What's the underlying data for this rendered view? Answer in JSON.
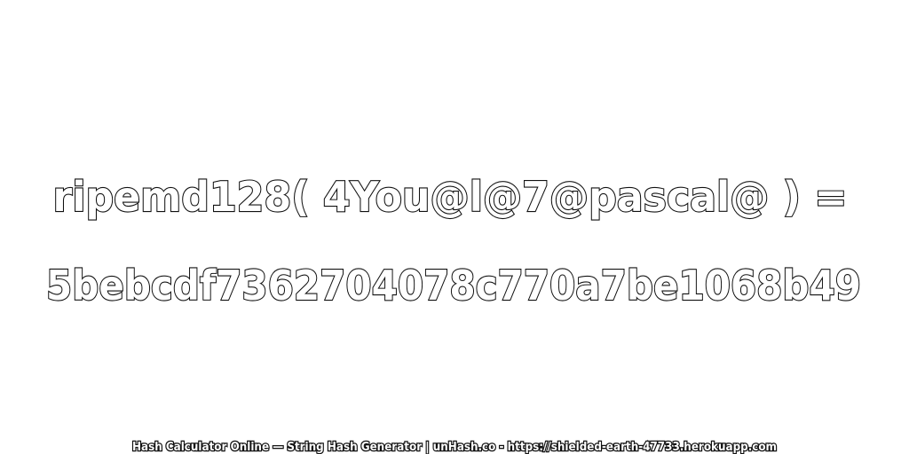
{
  "expression": "ripemd128( 4You@l@7@pascal@ ) =",
  "hash": "5bebcdf7362704078c770a7be1068b49",
  "footer": "Hash Calculator Online — String Hash Generator | unHash.co - https://shielded-earth-47733.herokuapp.com",
  "colors": {
    "background": "#ffffff",
    "text_fill": "#ffffff",
    "text_outline": "#111111"
  }
}
